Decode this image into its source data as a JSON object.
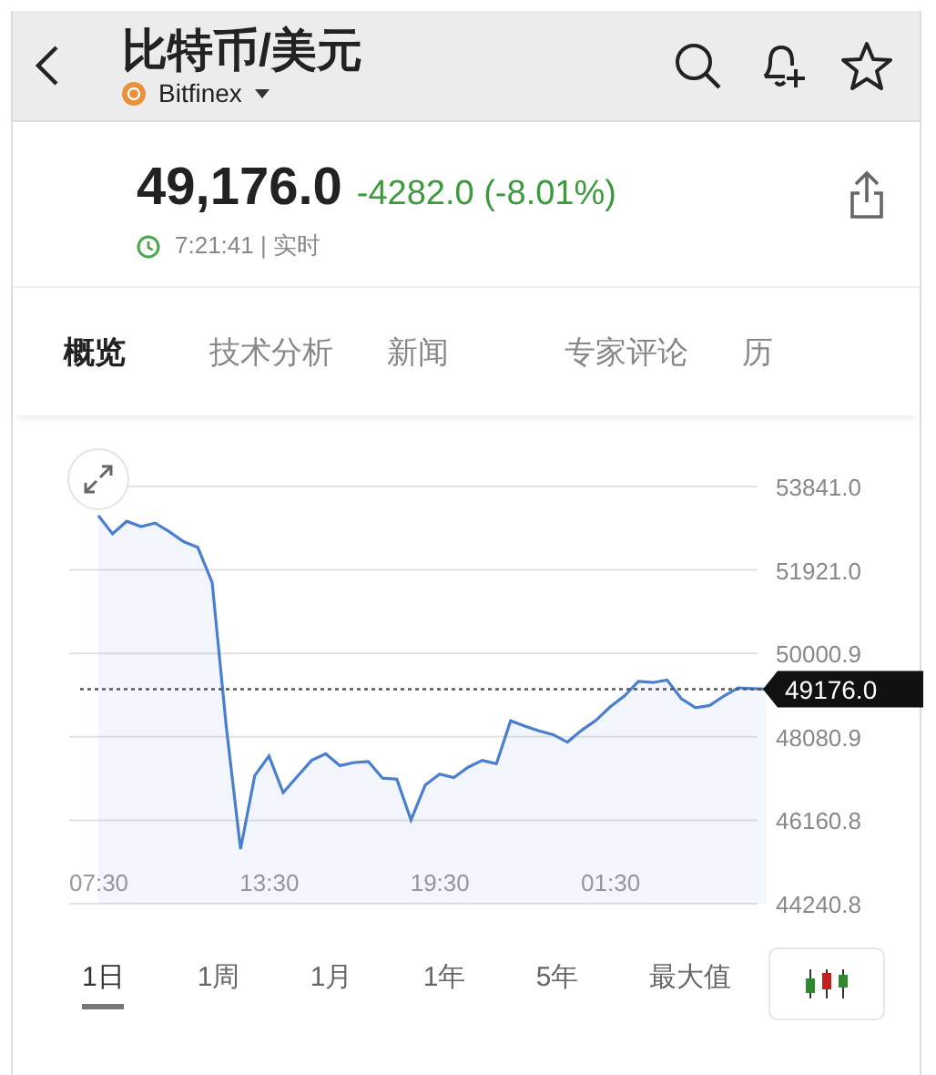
{
  "header": {
    "title": "比特币/美元",
    "exchange": "Bitfinex"
  },
  "quote": {
    "price": "49,176.0",
    "change": "-4282.0 (-8.01%)",
    "time": "7:21:41 | 实时"
  },
  "tabs": [
    {
      "label": "概览",
      "selected": true
    },
    {
      "label": "技术分析",
      "selected": false
    },
    {
      "label": "新闻",
      "selected": false
    },
    {
      "label": "专家评论",
      "selected": false
    },
    {
      "label": "历",
      "selected": false
    }
  ],
  "chart": {
    "chart_data": {
      "type": "area",
      "categories": [
        "07:30",
        null,
        null,
        null,
        null,
        null,
        null,
        null,
        null,
        null,
        null,
        null,
        "13:30",
        null,
        null,
        null,
        null,
        null,
        null,
        null,
        null,
        null,
        null,
        null,
        "19:30",
        null,
        null,
        null,
        null,
        null,
        null,
        null,
        null,
        null,
        null,
        null,
        "01:30",
        null,
        null,
        null,
        null,
        null,
        null,
        null,
        null,
        null,
        null,
        null
      ],
      "series": [
        {
          "color": "#4a7fd0",
          "values": [
            53170,
            52750,
            53040,
            52920,
            53000,
            52800,
            52570,
            52440,
            51630,
            48300,
            45500,
            47190,
            47640,
            46800,
            47170,
            47540,
            47690,
            47420,
            47490,
            47510,
            47130,
            47110,
            46170,
            46970,
            47220,
            47140,
            47380,
            47540,
            47460,
            48450,
            48330,
            48220,
            48130,
            47960,
            48230,
            48460,
            48770,
            49020,
            49360,
            49330,
            49390,
            48960,
            48750,
            48800,
            49020,
            49210,
            49190,
            49180
          ]
        }
      ],
      "ylim": [
        44240.8,
        53841.0
      ],
      "yticks": [
        {
          "value": 53841.0,
          "label": "53841.0"
        },
        {
          "value": 51921.0,
          "label": "51921.0"
        },
        {
          "value": 50000.9,
          "label": "50000.9"
        },
        {
          "value": 48080.9,
          "label": "48080.9"
        },
        {
          "value": 46160.8,
          "label": "46160.8"
        },
        {
          "value": 44240.8,
          "label": "44240.8"
        }
      ],
      "ref_lines": [
        {
          "axis": "y",
          "value": 49176.0,
          "label": "49176.0"
        }
      ],
      "grid": true
    }
  },
  "ranges": [
    {
      "label": "1日",
      "selected": true
    },
    {
      "label": "1周",
      "selected": false
    },
    {
      "label": "1月",
      "selected": false
    },
    {
      "label": "1年",
      "selected": false
    },
    {
      "label": "5年",
      "selected": false
    },
    {
      "label": "最大值",
      "selected": false
    }
  ]
}
